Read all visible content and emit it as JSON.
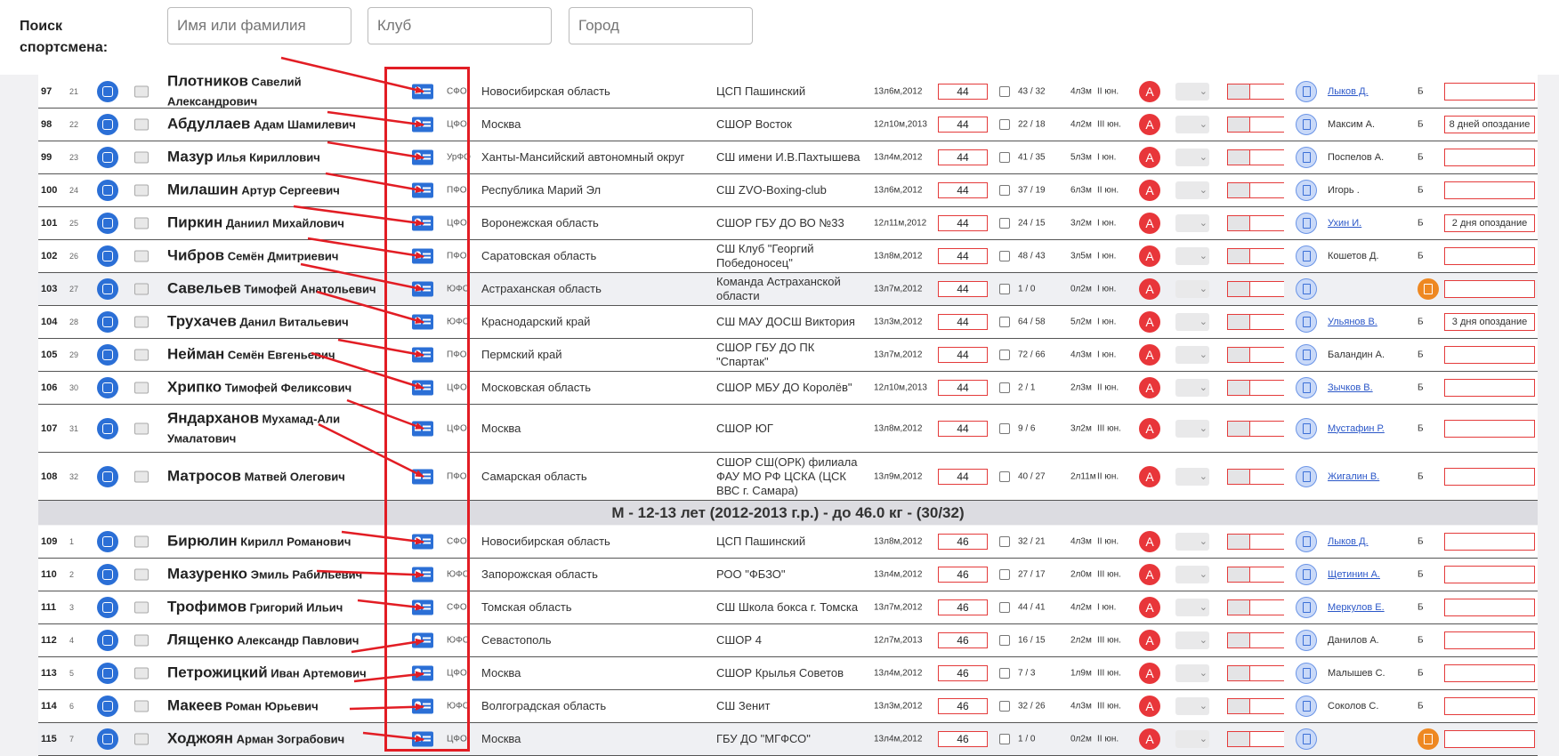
{
  "search": {
    "label": "Поиск спортсмена:",
    "name_placeholder": "Имя или фамилия",
    "club_placeholder": "Клуб",
    "city_placeholder": "Город"
  },
  "category_header": "М - 12-13 лет (2012-2013 г.р.) - до 46.0 кг - (30/32)",
  "rows": [
    {
      "num": "97",
      "sub": "21",
      "last": "Плотников",
      "first": "Савелий",
      "second": "Александрович",
      "fed": "СФО",
      "region": "Новосибирская область",
      "club": "ЦСП Пашинский",
      "age": "13л6м,2012",
      "weight": "44",
      "score": "43 / 32",
      "exp": "4л3м",
      "rank": "II юн.",
      "coach": "Лыков Д.",
      "coach_link": true,
      "b": "Б",
      "note": ""
    },
    {
      "num": "98",
      "sub": "22",
      "last": "Абдуллаев",
      "first": "Адам Шамилевич",
      "second": "",
      "fed": "ЦФО",
      "region": "Москва",
      "club": "СШОР Восток",
      "age": "12л10м,2013",
      "weight": "44",
      "score": "22 / 18",
      "exp": "4л2м",
      "rank": "III юн.",
      "coach": "Максим А.",
      "coach_link": false,
      "b": "Б",
      "note": "8 дней опоздание"
    },
    {
      "num": "99",
      "sub": "23",
      "last": "Мазур",
      "first": "Илья Кириллович",
      "second": "",
      "fed": "УрФО",
      "region": "Ханты-Мансийский автономный округ",
      "club": "СШ имени И.В.Пахтышева",
      "age": "13л4м,2012",
      "weight": "44",
      "score": "41 / 35",
      "exp": "5л3м",
      "rank": "I юн.",
      "coach": "Поспелов А.",
      "coach_link": false,
      "b": "Б",
      "note": ""
    },
    {
      "num": "100",
      "sub": "24",
      "last": "Милашин",
      "first": "Артур Сергеевич",
      "second": "",
      "fed": "ПФО",
      "region": "Республика Марий Эл",
      "club": "СШ ZVO-Boxing-club",
      "age": "13л6м,2012",
      "weight": "44",
      "score": "37 / 19",
      "exp": "6л3м",
      "rank": "II юн.",
      "coach": "Игорь .",
      "coach_link": false,
      "b": "Б",
      "note": ""
    },
    {
      "num": "101",
      "sub": "25",
      "last": "Пиркин",
      "first": "Даниил Михайлович",
      "second": "",
      "fed": "ЦФО",
      "region": "Воронежская область",
      "club": "СШОР ГБУ ДО ВО №33",
      "age": "12л11м,2012",
      "weight": "44",
      "score": "24 / 15",
      "exp": "3л2м",
      "rank": "I юн.",
      "coach": "Ухин И.",
      "coach_link": true,
      "b": "Б",
      "note": "2 дня опоздание"
    },
    {
      "num": "102",
      "sub": "26",
      "last": "Чибров",
      "first": "Семён Дмитриевич",
      "second": "",
      "fed": "ПФО",
      "region": "Саратовская область",
      "club": "СШ Клуб \"Георгий Победоносец\"",
      "age": "13л8м,2012",
      "weight": "44",
      "score": "48 / 43",
      "exp": "3л5м",
      "rank": "I юн.",
      "coach": "Кошетов Д.",
      "coach_link": false,
      "b": "Б",
      "note": ""
    },
    {
      "num": "103",
      "sub": "27",
      "last": "Савельев",
      "first": "Тимофей Анатольевич",
      "second": "",
      "fed": "ЮФО",
      "region": "Астраханская область",
      "club": "Команда Астраханской области",
      "age": "13л7м,2012",
      "weight": "44",
      "score": "1 / 0",
      "exp": "0л2м",
      "rank": "I юн.",
      "coach": "",
      "coach_link": false,
      "b": "",
      "note": "",
      "alt": true
    },
    {
      "num": "104",
      "sub": "28",
      "last": "Трухачев",
      "first": "Данил Витальевич",
      "second": "",
      "fed": "ЮФО",
      "region": "Краснодарский край",
      "club": "СШ МАУ ДОСШ Виктория",
      "age": "13л3м,2012",
      "weight": "44",
      "score": "64 / 58",
      "exp": "5л2м",
      "rank": "I юн.",
      "coach": "Ульянов В.",
      "coach_link": true,
      "b": "Б",
      "note": "3 дня опоздание"
    },
    {
      "num": "105",
      "sub": "29",
      "last": "Нейман",
      "first": "Семён Евгеньевич",
      "second": "",
      "fed": "ПФО",
      "region": "Пермский край",
      "club": "СШОР ГБУ ДО ПК \"Спартак\"",
      "age": "13л7м,2012",
      "weight": "44",
      "score": "72 / 66",
      "exp": "4л3м",
      "rank": "I юн.",
      "coach": "Баландин А.",
      "coach_link": false,
      "b": "Б",
      "note": ""
    },
    {
      "num": "106",
      "sub": "30",
      "last": "Хрипко",
      "first": "Тимофей Феликсович",
      "second": "",
      "fed": "ЦФО",
      "region": "Московская область",
      "club": "СШОР МБУ ДО Королёв\"",
      "age": "12л10м,2013",
      "weight": "44",
      "score": "2 / 1",
      "exp": "2л3м",
      "rank": "II юн.",
      "coach": "Зычков В.",
      "coach_link": true,
      "b": "Б",
      "note": ""
    },
    {
      "num": "107",
      "sub": "31",
      "last": "Яндарханов",
      "first": "Мухамад-Али",
      "second": "Умалатович",
      "fed": "ЦФО",
      "region": "Москва",
      "club": "СШОР ЮГ",
      "age": "13л8м,2012",
      "weight": "44",
      "score": "9 / 6",
      "exp": "3л2м",
      "rank": "III юн.",
      "coach": "Мустафин Р.",
      "coach_link": true,
      "b": "Б",
      "note": ""
    },
    {
      "num": "108",
      "sub": "32",
      "last": "Матросов",
      "first": "Матвей Олегович",
      "second": "",
      "fed": "ПФО",
      "region": "Самарская область",
      "club": "СШОР СШ(ОРК) филиала ФАУ МО РФ ЦСКА (ЦСК ВВС г. Самара)",
      "age": "13л9м,2012",
      "weight": "44",
      "score": "40 / 27",
      "exp": "2л11м",
      "rank": "II юн.",
      "coach": "Жигалин В.",
      "coach_link": true,
      "b": "Б",
      "note": ""
    },
    {
      "num": "109",
      "sub": "1",
      "last": "Бирюлин",
      "first": "Кирилл Романович",
      "second": "",
      "fed": "СФО",
      "region": "Новосибирская область",
      "club": "ЦСП Пашинский",
      "age": "13л8м,2012",
      "weight": "46",
      "score": "32 / 21",
      "exp": "4л3м",
      "rank": "II юн.",
      "coach": "Лыков Д.",
      "coach_link": true,
      "b": "Б",
      "note": ""
    },
    {
      "num": "110",
      "sub": "2",
      "last": "Мазуренко",
      "first": "Эмиль Рабильевич",
      "second": "",
      "fed": "ЮФО",
      "region": "Запорожская область",
      "club": "РОО \"ФБЗО\"",
      "age": "13л4м,2012",
      "weight": "46",
      "score": "27 / 17",
      "exp": "2л0м",
      "rank": "III юн.",
      "coach": "Щетинин А.",
      "coach_link": true,
      "b": "Б",
      "note": ""
    },
    {
      "num": "111",
      "sub": "3",
      "last": "Трофимов",
      "first": "Григорий Ильич",
      "second": "",
      "fed": "СФО",
      "region": "Томская область",
      "club": "СШ Школа бокса г. Томска",
      "age": "13л7м,2012",
      "weight": "46",
      "score": "44 / 41",
      "exp": "4л2м",
      "rank": "I юн.",
      "coach": "Меркулов Е.",
      "coach_link": true,
      "b": "Б",
      "note": ""
    },
    {
      "num": "112",
      "sub": "4",
      "last": "Лященко",
      "first": "Александр Павлович",
      "second": "",
      "fed": "ЮФО",
      "region": "Севастополь",
      "club": "СШОР 4",
      "age": "12л7м,2013",
      "weight": "46",
      "score": "16 / 15",
      "exp": "2л2м",
      "rank": "III юн.",
      "coach": "Данилов А.",
      "coach_link": false,
      "b": "Б",
      "note": ""
    },
    {
      "num": "113",
      "sub": "5",
      "last": "Петрожицкий",
      "first": "Иван Артемович",
      "second": "",
      "fed": "ЦФО",
      "region": "Москва",
      "club": "СШОР Крылья Советов",
      "age": "13л4м,2012",
      "weight": "46",
      "score": "7 / 3",
      "exp": "1л9м",
      "rank": "III юн.",
      "coach": "Малышев С.",
      "coach_link": false,
      "b": "Б",
      "note": ""
    },
    {
      "num": "114",
      "sub": "6",
      "last": "Макеев",
      "first": "Роман Юрьевич",
      "second": "",
      "fed": "ЮФО",
      "region": "Волгоградская область",
      "club": "СШ Зенит",
      "age": "13л3м,2012",
      "weight": "46",
      "score": "32 / 26",
      "exp": "4л3м",
      "rank": "III юн.",
      "coach": "Соколов С.",
      "coach_link": false,
      "b": "Б",
      "note": ""
    },
    {
      "num": "115",
      "sub": "7",
      "last": "Ходжоян",
      "first": "Арман Зограбович",
      "second": "",
      "fed": "ЦФО",
      "region": "Москва",
      "club": "ГБУ ДО \"МГФСО\"",
      "age": "13л4м,2012",
      "weight": "46",
      "score": "1 / 0",
      "exp": "0л2м",
      "rank": "II юн.",
      "coach": "",
      "coach_link": false,
      "b": "",
      "note": "",
      "alt": true
    }
  ],
  "colors": {
    "accent_blue": "#2b6fd6",
    "red": "#e21d24",
    "orange": "#ee8822",
    "row_alt": "#eff0f3",
    "category_bg": "#dcdce1"
  }
}
